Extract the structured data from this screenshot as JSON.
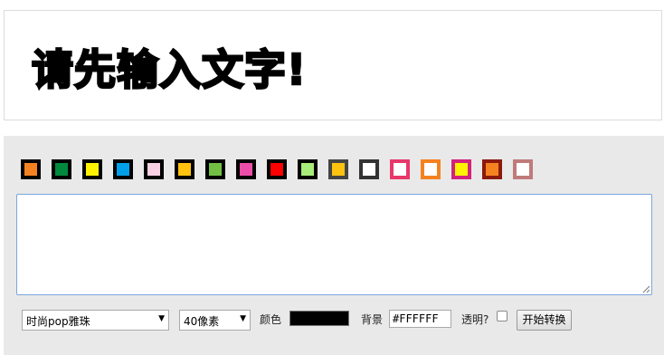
{
  "preview": {
    "text": "请先输入文字!"
  },
  "swatches": [
    {
      "fill": "#f58220",
      "border": "#000000",
      "name": "orange"
    },
    {
      "fill": "#008a3e",
      "border": "#000000",
      "name": "green"
    },
    {
      "fill": "#fff200",
      "border": "#000000",
      "name": "yellow"
    },
    {
      "fill": "#00a0e9",
      "border": "#000000",
      "name": "blue"
    },
    {
      "fill": "#f9cfe3",
      "border": "#000000",
      "name": "light-pink"
    },
    {
      "fill": "#ffc20e",
      "border": "#000000",
      "name": "gold"
    },
    {
      "fill": "#72bf44",
      "border": "#000000",
      "name": "leaf-green"
    },
    {
      "fill": "#ec4da8",
      "border": "#000000",
      "name": "pink"
    },
    {
      "fill": "#ff0000",
      "border": "#000000",
      "name": "red"
    },
    {
      "fill": "#a8ec7a",
      "border": "#000000",
      "name": "light-green"
    },
    {
      "fill": "#ffc20e",
      "border": "#444444",
      "name": "gold-gray-border"
    },
    {
      "fill": "#ffffff",
      "border": "#333333",
      "name": "white-dark-border"
    },
    {
      "fill": "#ffffff",
      "border": "#e8386b",
      "name": "white-pink-border"
    },
    {
      "fill": "#ffffff",
      "border": "#f58220",
      "name": "white-orange-border"
    },
    {
      "fill": "#fff200",
      "border": "#d4217e",
      "name": "yellow-magenta-border"
    },
    {
      "fill": "#f58220",
      "border": "#8b1a0e",
      "name": "orange-brown-border"
    },
    {
      "fill": "#ffffff",
      "border": "#c07a7a",
      "name": "white-rose-border"
    }
  ],
  "controls": {
    "text_value": "",
    "font_select": "时尚pop雅珠",
    "size_select": "40像素",
    "color_label": "颜色",
    "color_value": "#000000",
    "bg_label": "背景",
    "bg_value": "#FFFFFF",
    "transparent_label": "透明?",
    "submit_label": "开始转换"
  }
}
